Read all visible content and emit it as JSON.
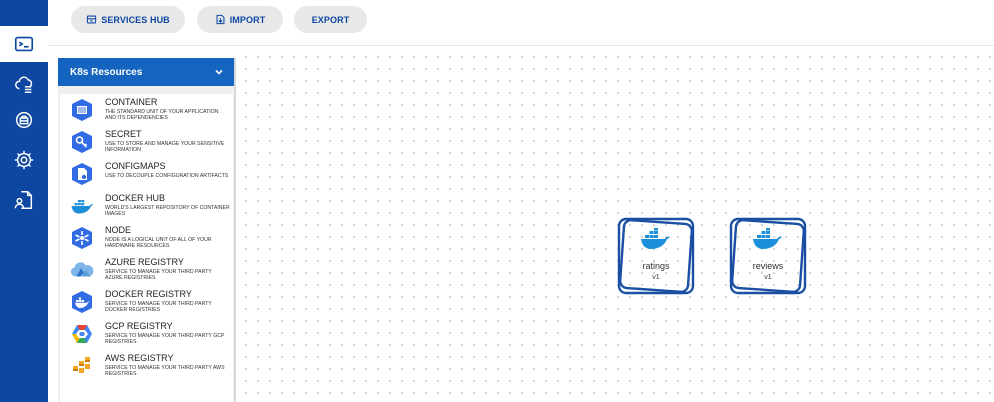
{
  "toolbar": {
    "services_hub_label": "SERVICES HUB",
    "import_label": "IMPORT",
    "export_label": "EXPORT"
  },
  "rail": {
    "items": [
      {
        "icon": "terminal-icon",
        "active": true
      },
      {
        "icon": "cloud-list-icon"
      },
      {
        "icon": "registry-icon"
      },
      {
        "icon": "gear-icon"
      },
      {
        "icon": "user-document-icon"
      }
    ]
  },
  "panel": {
    "title": "K8s Resources",
    "items": [
      {
        "title": "CONTAINER",
        "desc": "THE STANDARD UNIT OF YOUR APPLICATION AND ITS DEPENDENCIES",
        "icon": "container-icon"
      },
      {
        "title": "SECRET",
        "desc": "USE TO STORE AND MANAGE YOUR SENSITIVE INFORMATION",
        "icon": "key-icon"
      },
      {
        "title": "CONFIGMAPS",
        "desc": "USE TO DECOUPLE CONFIGURATION ARTIFACTS",
        "icon": "configmap-icon"
      },
      {
        "title": "DOCKER HUB",
        "desc": "WORLD'S LARGEST REPOSITORY OF CONTAINER IMAGES",
        "icon": "docker-icon"
      },
      {
        "title": "NODE",
        "desc": "NODE IS A LOGICAL UNIT OF ALL OF YOUR HARDWARE RESOURCES",
        "icon": "node-icon"
      },
      {
        "title": "AZURE REGISTRY",
        "desc": "SERVICE TO MANAGE YOUR THIRD PARTY AZURE REGISTRIES",
        "icon": "azure-cloud-icon"
      },
      {
        "title": "DOCKER REGISTRY",
        "desc": "SERVICE TO MANAGE YOUR THIRD PARTY DOCKER REGISTRIES",
        "icon": "docker-registry-icon"
      },
      {
        "title": "GCP REGISTRY",
        "desc": "SERVICE TO MANAGE YOUR THIRD PARTY GCP REGISTRIES",
        "icon": "gcp-icon"
      },
      {
        "title": "AWS REGISTRY",
        "desc": "SERVICE TO MANAGE YOUR THIRD PARTY AWS REGISTRIES",
        "icon": "aws-icon"
      }
    ]
  },
  "canvas": {
    "nodes": [
      {
        "name": "ratings",
        "version": "v1",
        "icon": "docker-whale-icon"
      },
      {
        "name": "reviews",
        "version": "v1",
        "icon": "docker-whale-icon"
      }
    ]
  },
  "colors": {
    "primary": "#0d47a1",
    "header_blue": "#1565c0",
    "node_border": "#1a4fa3",
    "docker_blue": "#1d8fd8"
  }
}
